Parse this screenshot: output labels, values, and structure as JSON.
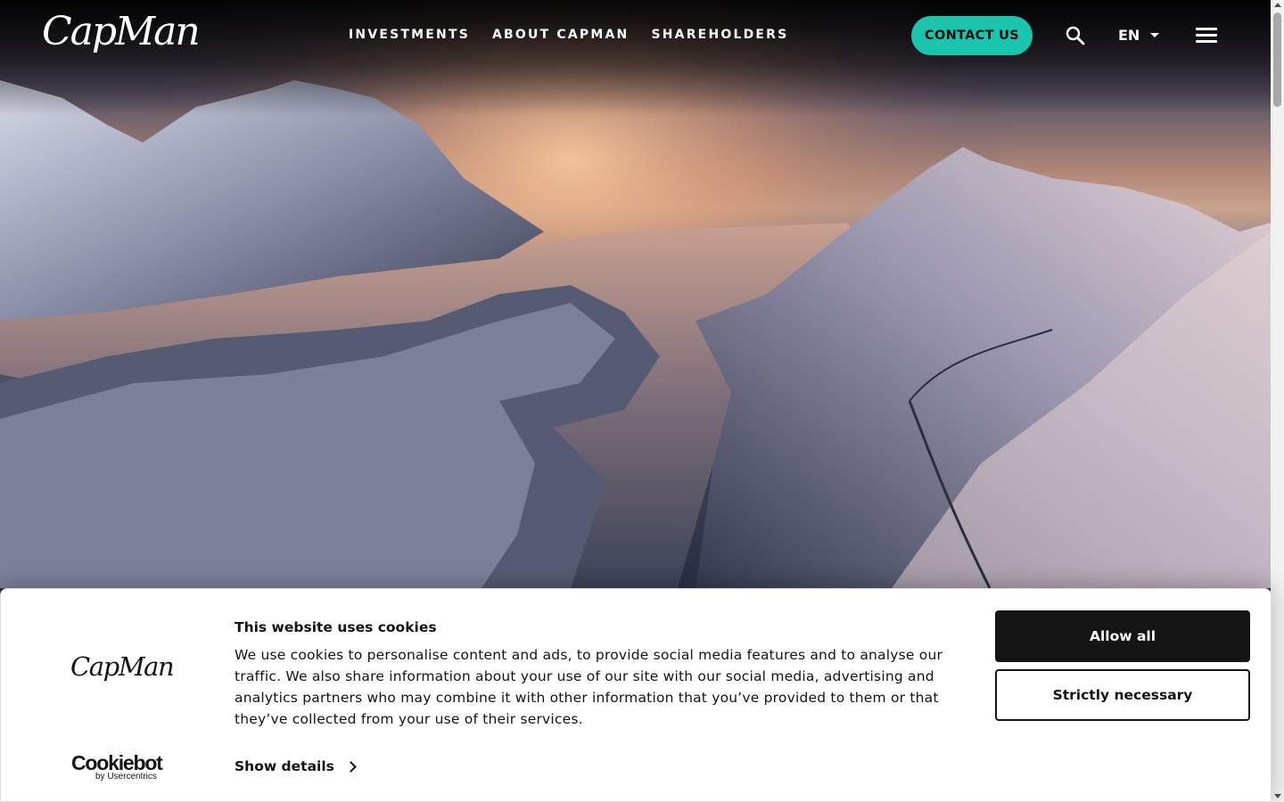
{
  "header": {
    "logo": "CapMan",
    "nav": [
      "INVESTMENTS",
      "ABOUT CAPMAN",
      "SHAREHOLDERS"
    ],
    "contact_label": "CONTACT US",
    "language": "EN",
    "accent_color": "#1cc4ae"
  },
  "hero": {
    "image": "snowy mountains and fjord at sunset"
  },
  "cookie_banner": {
    "logo": "CapMan",
    "title": "This website uses cookies",
    "text": "We use cookies to personalise content and ads, to provide social media features and to analyse our traffic. We also share information about your use of our site with our social media, advertising and analytics partners who may combine it with other information that you’ve provided to them or that they’ve collected from your use of their services.",
    "show_details": "Show details",
    "allow_all": "Allow all",
    "strictly_necessary": "Strictly necessary",
    "provider_main": "Cookiebot",
    "provider_sub": "by Usercentrics"
  }
}
